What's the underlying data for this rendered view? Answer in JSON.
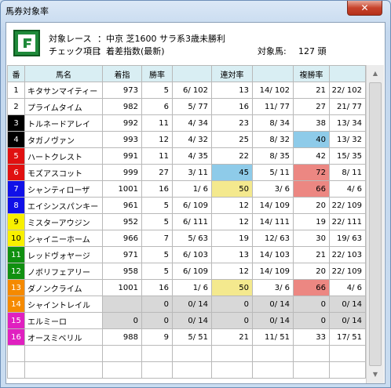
{
  "window": {
    "title": "馬券対象率",
    "close_glyph": "✕"
  },
  "info": {
    "race_label": "対象レース",
    "race_value": "：中京 芝1600  サラ系3歳未勝利",
    "check_label": "チェック項目",
    "check_value": "：着差指数(最新)",
    "count_label": "対象馬:",
    "count_value": "127 頭"
  },
  "columns": [
    "番",
    "馬名",
    "着指",
    "勝率",
    "",
    "連対率",
    "",
    "複勝率",
    ""
  ],
  "gate_colors": {
    "1": "#ffffff",
    "2": "#ffffff",
    "3": "#000000",
    "4": "#000000",
    "5": "#e01010",
    "6": "#e01010",
    "7": "#1010e8",
    "8": "#1010e8",
    "9": "#f8f000",
    "10": "#f8f000",
    "11": "#109010",
    "12": "#109010",
    "13": "#f58a00",
    "14": "#f58a00",
    "15": "#e020c0",
    "16": "#e020c0"
  },
  "rows": [
    {
      "no": "1",
      "name": "キタサンマイティー",
      "idx": "973",
      "w": "5",
      "wr": "6/ 102",
      "r": "13",
      "rr": "14/ 102",
      "p": "21",
      "pr": "22/ 102"
    },
    {
      "no": "2",
      "name": "プライムタイム",
      "idx": "982",
      "w": "6",
      "wr": "5/ 77",
      "r": "16",
      "rr": "11/ 77",
      "p": "27",
      "pr": "21/ 77"
    },
    {
      "no": "3",
      "name": "トルネードアレイ",
      "idx": "992",
      "w": "11",
      "wr": "4/ 34",
      "r": "23",
      "rr": "8/ 34",
      "p": "38",
      "pr": "13/ 34"
    },
    {
      "no": "4",
      "name": "タガノヴァン",
      "idx": "993",
      "w": "12",
      "wr": "4/ 32",
      "r": "25",
      "rr": "8/ 32",
      "p": "40",
      "pr": "13/ 32",
      "p_hl": "blue"
    },
    {
      "no": "5",
      "name": "ハートクレスト",
      "idx": "991",
      "w": "11",
      "wr": "4/ 35",
      "r": "22",
      "rr": "8/ 35",
      "p": "42",
      "pr": "15/ 35"
    },
    {
      "no": "6",
      "name": "モズアスコット",
      "idx": "999",
      "w": "27",
      "wr": "3/ 11",
      "r": "45",
      "rr": "5/ 11",
      "p": "72",
      "pr": "8/ 11",
      "r_hl": "blue",
      "p_hl": "red"
    },
    {
      "no": "7",
      "name": "シャンティローザ",
      "idx": "1001",
      "w": "16",
      "wr": "1/ 6",
      "r": "50",
      "rr": "3/ 6",
      "p": "66",
      "pr": "4/ 6",
      "r_hl": "yellow",
      "p_hl": "red"
    },
    {
      "no": "8",
      "name": "エイシンスパンキー",
      "idx": "961",
      "w": "5",
      "wr": "6/ 109",
      "r": "12",
      "rr": "14/ 109",
      "p": "20",
      "pr": "22/ 109"
    },
    {
      "no": "9",
      "name": "ミスターアウジン",
      "idx": "952",
      "w": "5",
      "wr": "6/ 111",
      "r": "12",
      "rr": "14/ 111",
      "p": "19",
      "pr": "22/ 111"
    },
    {
      "no": "10",
      "name": "シャイニーホーム",
      "idx": "966",
      "w": "7",
      "wr": "5/ 63",
      "r": "19",
      "rr": "12/ 63",
      "p": "30",
      "pr": "19/ 63"
    },
    {
      "no": "11",
      "name": "レッドヴォヤージ",
      "idx": "971",
      "w": "5",
      "wr": "6/ 103",
      "r": "13",
      "rr": "14/ 103",
      "p": "21",
      "pr": "22/ 103"
    },
    {
      "no": "12",
      "name": "ノボリフェアリー",
      "idx": "958",
      "w": "5",
      "wr": "6/ 109",
      "r": "12",
      "rr": "14/ 109",
      "p": "20",
      "pr": "22/ 109"
    },
    {
      "no": "13",
      "name": "ダノンクライム",
      "idx": "1001",
      "w": "16",
      "wr": "1/ 6",
      "r": "50",
      "rr": "3/ 6",
      "p": "66",
      "pr": "4/ 6",
      "r_hl": "yellow",
      "p_hl": "red"
    },
    {
      "no": "14",
      "name": "シャイントレイル",
      "idx": "",
      "w": "0",
      "wr": "0/ 14",
      "r": "0",
      "rr": "0/ 14",
      "p": "0",
      "pr": "0/ 14",
      "gray": true
    },
    {
      "no": "15",
      "name": "エルミーロ",
      "idx": "0",
      "w": "0",
      "wr": "0/ 14",
      "r": "0",
      "rr": "0/ 14",
      "p": "0",
      "pr": "0/ 14",
      "gray": true
    },
    {
      "no": "16",
      "name": "オースミベリル",
      "idx": "988",
      "w": "9",
      "wr": "5/ 51",
      "r": "21",
      "rr": "11/ 51",
      "p": "33",
      "pr": "17/ 51"
    }
  ]
}
